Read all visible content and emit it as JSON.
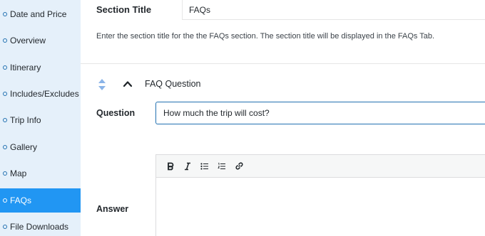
{
  "sidebar": {
    "items": [
      {
        "label": "Date and Price"
      },
      {
        "label": "Overview"
      },
      {
        "label": "Itinerary"
      },
      {
        "label": "Includes/Excludes"
      },
      {
        "label": "Trip Info"
      },
      {
        "label": "Gallery"
      },
      {
        "label": "Map"
      },
      {
        "label": "FAQs"
      },
      {
        "label": "File Downloads"
      }
    ],
    "active": "FAQs",
    "accent_color": "#2196f3",
    "background_color": "#e5f0fa"
  },
  "section": {
    "title_label": "Section Title",
    "title_value": "FAQs",
    "description": "Enter the section title for the the FAQs section. The section title will be displayed in the FAQs Tab."
  },
  "faq": {
    "heading": "FAQ Question",
    "question_label": "Question",
    "question_value": "How much the trip will cost?",
    "answer_label": "Answer",
    "toolbar": [
      "bold-icon",
      "italic-icon",
      "bullet-list-icon",
      "numbered-list-icon",
      "link-icon"
    ]
  }
}
